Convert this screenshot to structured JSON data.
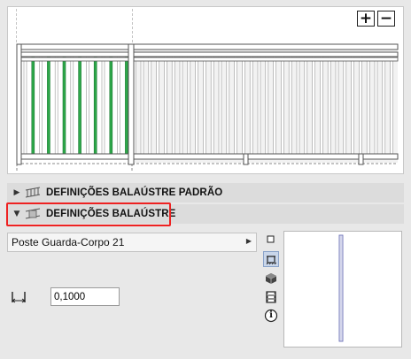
{
  "preview": {
    "zoom_in_label": "+",
    "zoom_out_label": "−",
    "colors": {
      "highlight": "#2ea84a",
      "frame": "#555555",
      "guide": "#888888"
    }
  },
  "sections": {
    "default_title": "DEFINIÇÕES BALAÚSTRE PADRÃO",
    "current_title": "DEFINIÇÕES BALAÚSTRE",
    "collapsed_arrow": "▶",
    "expanded_arrow": "▼"
  },
  "panel": {
    "profile_name": "Poste Guarda-Corpo 21",
    "dropdown_arrow": "▶",
    "width_value": "0,1000",
    "icons": [
      "square-outline-icon",
      "railing-view-icon",
      "3d-box-icon",
      "film-strip-icon",
      "info-icon"
    ],
    "info_glyph": "i"
  },
  "colors": {
    "highlight_frame": "#e22222",
    "section_bg": "#dcdcdc",
    "active_icon_bg": "#c9d6ea"
  }
}
